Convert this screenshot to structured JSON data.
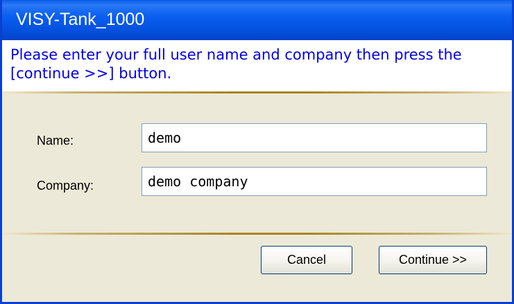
{
  "window": {
    "title": "VISY-Tank_1000"
  },
  "instruction": {
    "text": "Please enter your full user name and company then press the [continue >>] button."
  },
  "form": {
    "name_label": "Name:",
    "name_value": "demo",
    "company_label": "Company:",
    "company_value": "demo company"
  },
  "buttons": {
    "cancel_label": "Cancel",
    "continue_label": "Continue >>"
  },
  "colors": {
    "titlebar": "#0a5be8",
    "instruction_text": "#0000e6",
    "dialog_background": "#ece9d8",
    "divider": "#a88424"
  }
}
